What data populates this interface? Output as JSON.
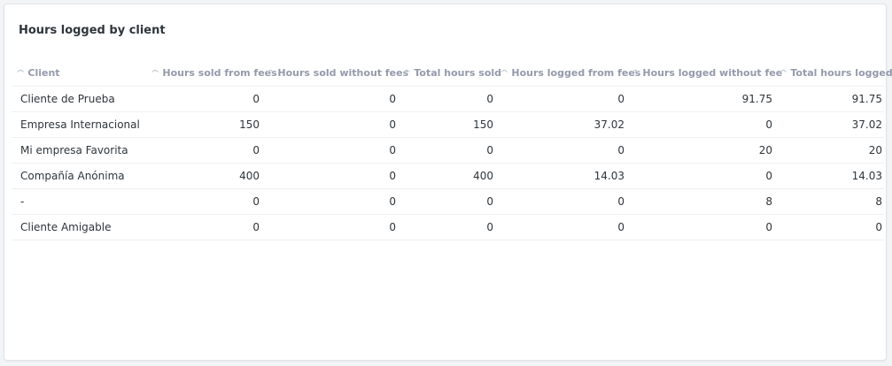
{
  "title": "Hours logged by client",
  "columns": [
    "Client",
    "Hours sold from fees",
    "Hours sold without fees",
    "Total hours sold",
    "Hours logged from fees",
    "Hours logged without fee",
    "Total hours logged"
  ],
  "rows": [
    [
      "Cliente de Prueba",
      "0",
      "0",
      "0",
      "0",
      "91.75",
      "91.75"
    ],
    [
      "Empresa Internacional",
      "150",
      "0",
      "150",
      "37.02",
      "0",
      "37.02"
    ],
    [
      "Mi empresa Favorita",
      "0",
      "0",
      "0",
      "0",
      "20",
      "20"
    ],
    [
      "Compañía Anónima",
      "400",
      "0",
      "400",
      "14.03",
      "0",
      "14.03"
    ],
    [
      "-",
      "0",
      "0",
      "0",
      "0",
      "8",
      "8"
    ],
    [
      "Cliente Amigable",
      "0",
      "0",
      "0",
      "0",
      "0",
      "0"
    ]
  ]
}
